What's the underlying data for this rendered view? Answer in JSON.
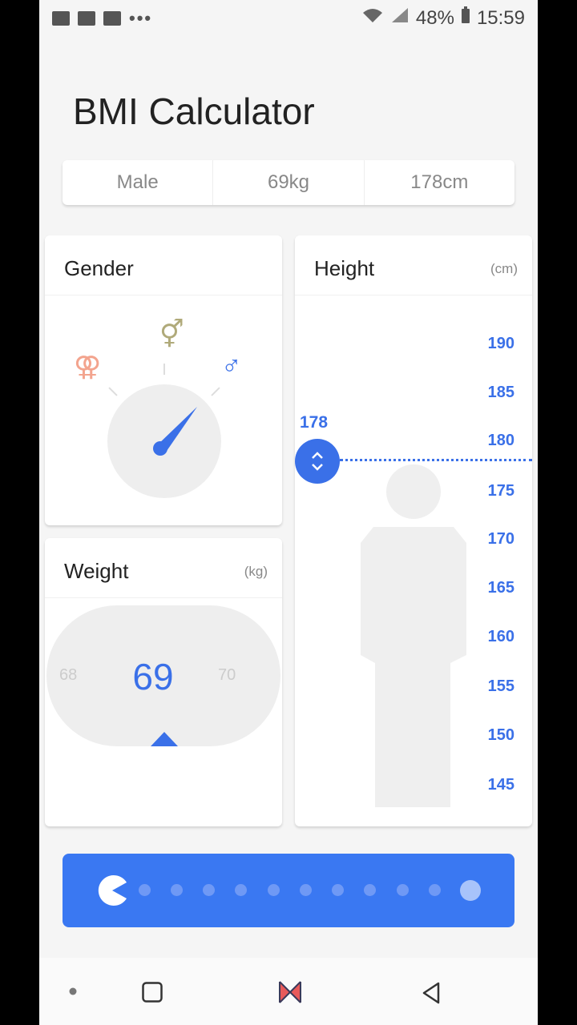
{
  "status_bar": {
    "battery": "48%",
    "time": "15:59",
    "dots": "•••"
  },
  "app": {
    "title": "BMI Calculator"
  },
  "summary": {
    "gender": "Male",
    "weight": "69kg",
    "height": "178cm"
  },
  "gender_card": {
    "title": "Gender",
    "female_symbol": "⚢",
    "other_symbol": "⚥",
    "male_symbol": "♂"
  },
  "weight_card": {
    "title": "Weight",
    "unit": "(kg)",
    "value": "69",
    "prev": "68",
    "next": "70"
  },
  "height_card": {
    "title": "Height",
    "unit": "(cm)",
    "value": "178",
    "scale": [
      "190",
      "185",
      "180",
      "175",
      "170",
      "165",
      "160",
      "155",
      "150",
      "145"
    ]
  },
  "colors": {
    "accent": "#3a70e8",
    "button": "#3a78f2",
    "female": "#f3a48e",
    "other": "#b0aa7a"
  }
}
